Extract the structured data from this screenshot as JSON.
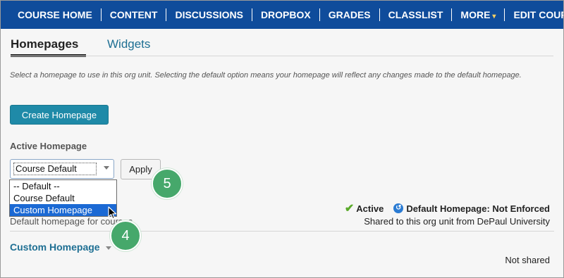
{
  "nav": {
    "items": [
      {
        "label": "COURSE HOME"
      },
      {
        "label": "CONTENT"
      },
      {
        "label": "DISCUSSIONS"
      },
      {
        "label": "DROPBOX"
      },
      {
        "label": "GRADES"
      },
      {
        "label": "CLASSLIST"
      },
      {
        "label": "MORE",
        "caret": "▾"
      },
      {
        "label": "EDIT COURSE"
      }
    ]
  },
  "tabs": {
    "active": "Homepages",
    "inactive": "Widgets"
  },
  "description": "Select a homepage to use in this org unit. Selecting the default option means your homepage will reflect any changes made to the default homepage.",
  "create_button": "Create Homepage",
  "active_homepage": {
    "label": "Active Homepage",
    "selected_value": "Course Default",
    "apply_button": "Apply",
    "options": [
      "-- Default --",
      "Course Default",
      "Custom Homepage"
    ],
    "highlighted_index": 2
  },
  "badges": {
    "five": "5",
    "four": "4"
  },
  "default_row": {
    "status_check": "✔",
    "status_active": "Active",
    "info_glyph": "↺",
    "status_default": "Default Homepage: Not Enforced",
    "description": "Default homepage for courses",
    "shared": "Shared to this org unit from DePaul University"
  },
  "custom_row": {
    "title": "Custom Homepage",
    "shared": "Not shared"
  },
  "colors": {
    "nav_bg": "#0f4c9b",
    "primary_button": "#1f8aa8",
    "link": "#1e6f93",
    "badge": "#46a86b",
    "selection": "#1b69d4"
  }
}
